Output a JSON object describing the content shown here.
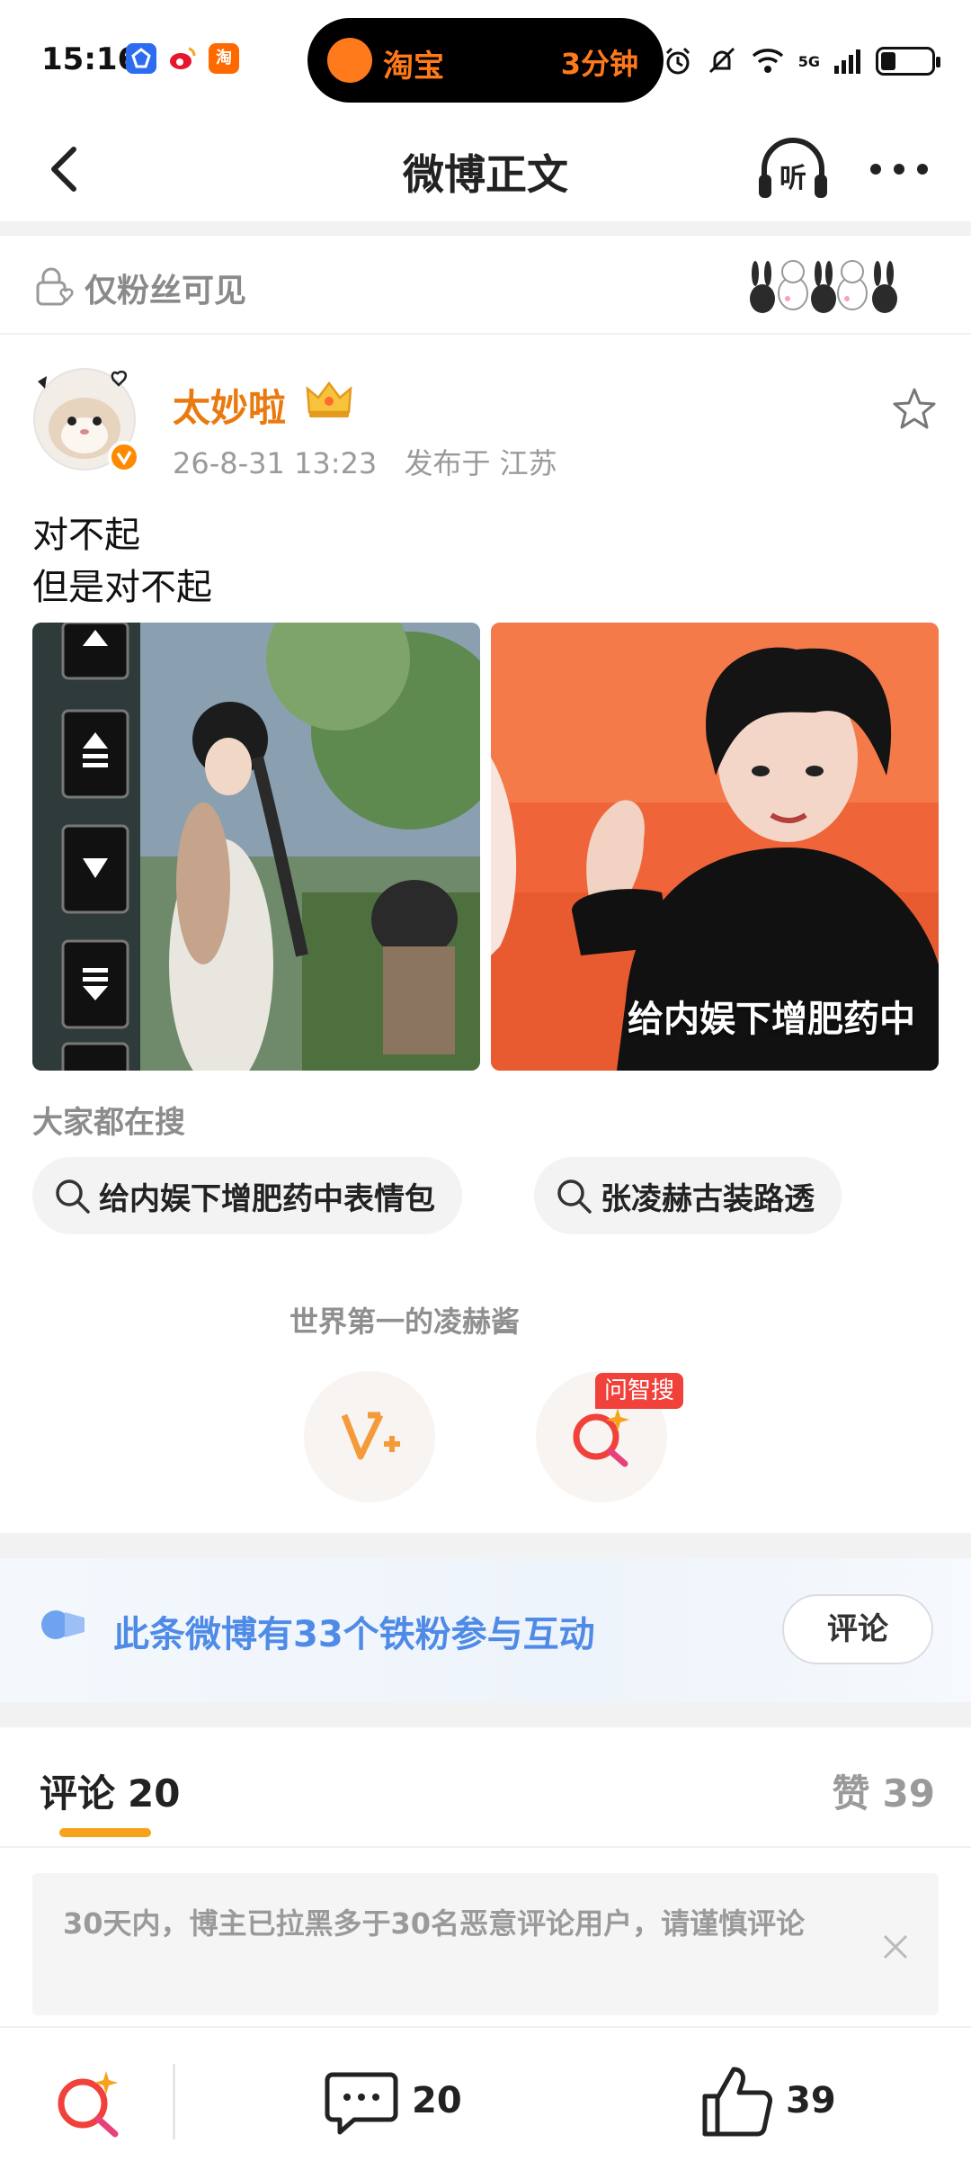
{
  "status_bar": {
    "time": "15:16",
    "app_icons": [
      "alipay-icon",
      "weibo-icon",
      "taobao-icon"
    ],
    "taobao_label": "淘",
    "live_activity": {
      "app": "淘宝",
      "duration": "3分钟"
    },
    "network": "5G",
    "battery_level": 0.3
  },
  "nav": {
    "title": "微博正文",
    "listen_label": "听"
  },
  "visibility": {
    "label": "仅粉丝可见"
  },
  "post": {
    "author": "太妙啦",
    "timestamp": "26-8-31 13:23",
    "location": "发布于  江苏",
    "text_lines": [
      "对不起",
      "但是对不起"
    ],
    "images": [
      {
        "caption": ""
      },
      {
        "caption": "给内娱下增肥药中"
      }
    ]
  },
  "hot_search": {
    "title": "大家都在搜",
    "items": [
      "给内娱下增肥药中表情包",
      "张凌赫古装路透"
    ]
  },
  "supporter": {
    "label": "世界第一的凌赫酱",
    "ask_badge": "问智搜"
  },
  "fans_interact": {
    "text": "此条微博有33个铁粉参与互动",
    "button": "评论"
  },
  "comments_section": {
    "comments_label": "评论",
    "comments_count": "20",
    "likes_label": "赞",
    "likes_count": "39",
    "notice": "30天内，博主已拉黑多于30名恶意评论用户，请谨慎评论"
  },
  "bottom_bar": {
    "comment_count": "20",
    "like_count": "39"
  },
  "colors": {
    "author": "#ea7a0f",
    "accent_orange": "#f7a21a",
    "interact_blue": "#4f8be6",
    "badge_red": "#f0413a"
  }
}
